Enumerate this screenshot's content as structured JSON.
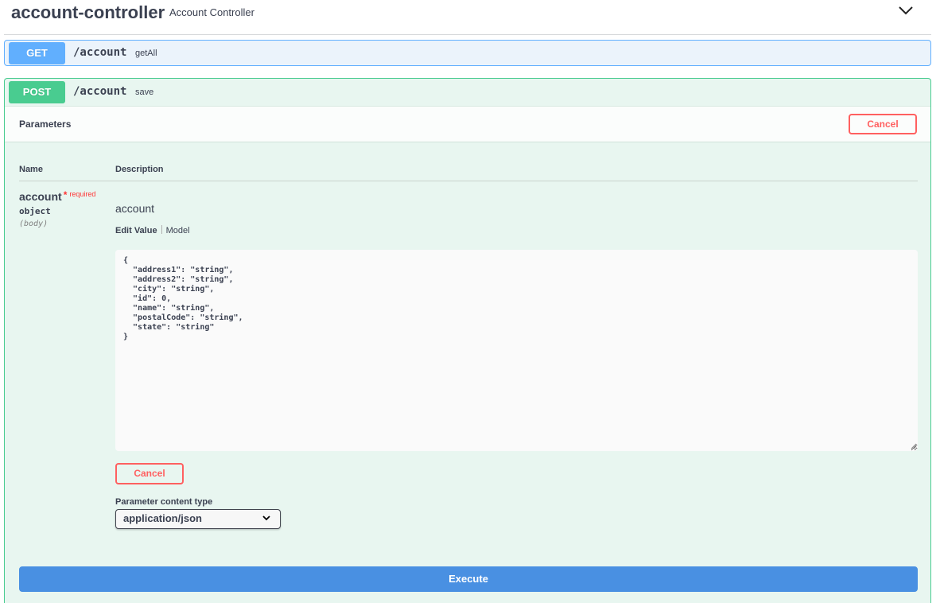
{
  "tag": {
    "name": "account-controller",
    "description": "Account Controller",
    "toggle_icon": "chevron-down-icon"
  },
  "operations": [
    {
      "method": "GET",
      "path": "/account",
      "summary": "getAll",
      "color": "#61affe",
      "expanded": false
    },
    {
      "method": "POST",
      "path": "/account",
      "summary": "save",
      "color": "#49cc90",
      "expanded": true
    }
  ],
  "parameters_section": {
    "title": "Parameters",
    "cancel_label": "Cancel",
    "columns": {
      "name": "Name",
      "description": "Description"
    },
    "param": {
      "name": "account",
      "required_star": "*",
      "required_label": "required",
      "type": "object",
      "location": "(body)",
      "description": "account"
    },
    "tabs": [
      "Edit Value",
      "Model"
    ],
    "active_tab": "Edit Value",
    "body_value": "{\n  \"address1\": \"string\",\n  \"address2\": \"string\",\n  \"city\": \"string\",\n  \"id\": 0,\n  \"name\": \"string\",\n  \"postalCode\": \"string\",\n  \"state\": \"string\"\n}",
    "cancel_bottom_label": "Cancel",
    "content_type_label": "Parameter content type",
    "content_type_selected": "application/json",
    "execute_label": "Execute"
  },
  "colors": {
    "get": "#61affe",
    "post": "#49cc90",
    "cancel": "#ff6060",
    "execute": "#4990e2"
  }
}
